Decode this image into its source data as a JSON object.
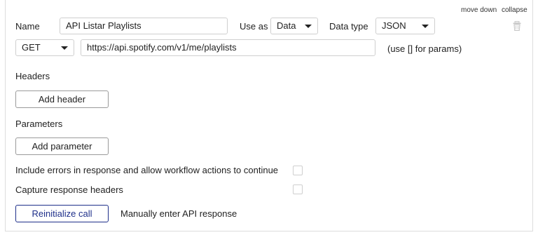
{
  "header": {
    "move_down": "move down",
    "collapse": "collapse"
  },
  "call": {
    "name_label": "Name",
    "name_value": "API Listar Playlists",
    "use_as_label": "Use as",
    "use_as_value": "Data",
    "data_type_label": "Data type",
    "data_type_value": "JSON",
    "method_value": "GET",
    "url_value": "https://api.spotify.com/v1/me/playlists",
    "params_hint": "(use [] for params)"
  },
  "headers_section": {
    "title": "Headers",
    "add_label": "Add header"
  },
  "parameters_section": {
    "title": "Parameters",
    "add_label": "Add parameter"
  },
  "options": {
    "include_errors_label": "Include errors in response and allow workflow actions to continue",
    "include_errors_checked": false,
    "capture_headers_label": "Capture response headers",
    "capture_headers_checked": false
  },
  "actions": {
    "reinitialize_label": "Reinitialize call",
    "manual_entry_label": "Manually enter API response"
  },
  "icons": {
    "delete": "trash-icon",
    "dropdown": "chevron-down-icon"
  },
  "colors": {
    "accent": "#1e2f8a",
    "border": "#cfcfcf"
  }
}
